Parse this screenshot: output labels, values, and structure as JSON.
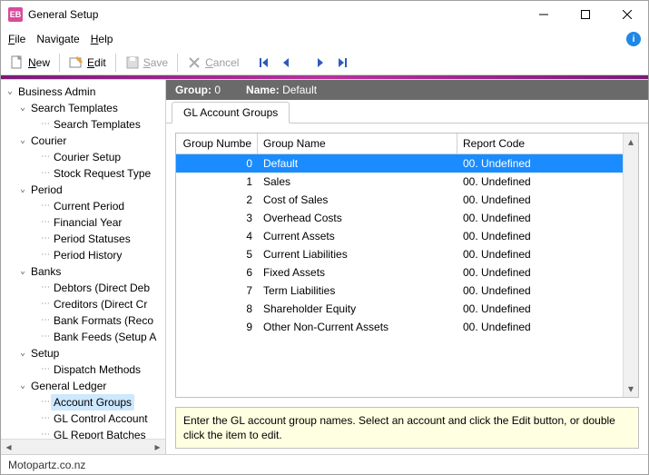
{
  "titlebar": {
    "app_code": "EB",
    "title": "General Setup"
  },
  "menu": {
    "file": "File",
    "navigate": "Navigate",
    "help": "Help"
  },
  "toolbar": {
    "new": "New",
    "edit": "Edit",
    "save": "Save",
    "cancel": "Cancel"
  },
  "tree": {
    "root": "Business Admin",
    "search_templates": "Search Templates",
    "search_templates_child": "Search Templates",
    "courier": "Courier",
    "courier_setup": "Courier Setup",
    "stock_request_type": "Stock Request Type",
    "period": "Period",
    "current_period": "Current Period",
    "financial_year": "Financial Year",
    "period_statuses": "Period Statuses",
    "period_history": "Period History",
    "banks": "Banks",
    "debtors": "Debtors (Direct Deb",
    "creditors": "Creditors (Direct Cr",
    "bank_formats": "Bank Formats (Reco",
    "bank_feeds": "Bank Feeds (Setup A",
    "setup": "Setup",
    "dispatch": "Dispatch Methods",
    "general_ledger": "General Ledger",
    "account_groups": "Account Groups",
    "gl_control": "GL Control Account",
    "gl_report_batches": "GL Report Batches"
  },
  "header": {
    "group_label": "Group:",
    "group_value": "0",
    "name_label": "Name:",
    "name_value": "Default"
  },
  "tab": "GL Account Groups",
  "columns": {
    "number": "Group Numbe",
    "name": "Group Name",
    "code": "Report Code"
  },
  "rows": [
    {
      "num": "0",
      "name": "Default",
      "code": "00. Undefined"
    },
    {
      "num": "1",
      "name": "Sales",
      "code": "00. Undefined"
    },
    {
      "num": "2",
      "name": "Cost of Sales",
      "code": "00. Undefined"
    },
    {
      "num": "3",
      "name": "Overhead Costs",
      "code": "00. Undefined"
    },
    {
      "num": "4",
      "name": "Current Assets",
      "code": "00. Undefined"
    },
    {
      "num": "5",
      "name": "Current Liabilities",
      "code": "00. Undefined"
    },
    {
      "num": "6",
      "name": "Fixed Assets",
      "code": "00. Undefined"
    },
    {
      "num": "7",
      "name": "Term Liabilities",
      "code": "00. Undefined"
    },
    {
      "num": "8",
      "name": "Shareholder Equity",
      "code": "00. Undefined"
    },
    {
      "num": "9",
      "name": "Other Non-Current Assets",
      "code": "00. Undefined"
    }
  ],
  "hint": "Enter the GL account group names. Select an account and click the Edit button, or double click the item to edit.",
  "status": "Motopartz.co.nz"
}
